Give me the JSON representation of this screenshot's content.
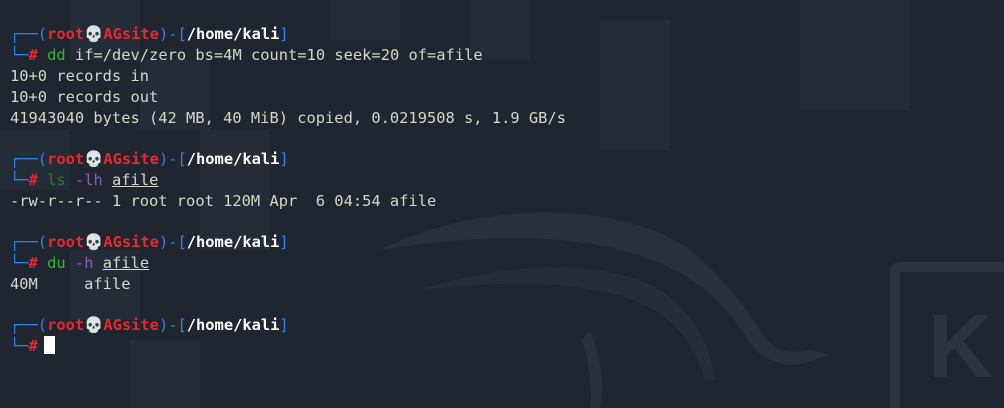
{
  "prompt": {
    "open_top": "┌──(",
    "close_mid": ")-[",
    "close_end": "]",
    "open_bottom": "└─",
    "user": "root",
    "skull": "💀",
    "host": "AGsite",
    "path": "/home/kali",
    "symbol": "#"
  },
  "blocks": [
    {
      "command": "dd",
      "args": " if=/dev/zero bs=4M count=10 seek=20 of=afile",
      "output": [
        "10+0 records in",
        "10+0 records out",
        "41943040 bytes (42 MB, 40 MiB) copied, 0.0219508 s, 1.9 GB/s"
      ]
    },
    {
      "command": "ls",
      "option": " -lh",
      "file": "afile",
      "output": [
        "-rw-r--r-- 1 root root 120M Apr  6 04:54 afile"
      ]
    },
    {
      "command": "du",
      "option": " -h",
      "file": "afile",
      "output": [
        "40M     afile"
      ]
    }
  ],
  "colors": {
    "background": "#1f2630",
    "frame": "#2f7ff0",
    "user_host": "#e8262e",
    "path": "#ffffff",
    "command": "#3ab03a",
    "option": "#8a5db8",
    "text": "#d3d7cf"
  },
  "background_logo_letter": "K"
}
